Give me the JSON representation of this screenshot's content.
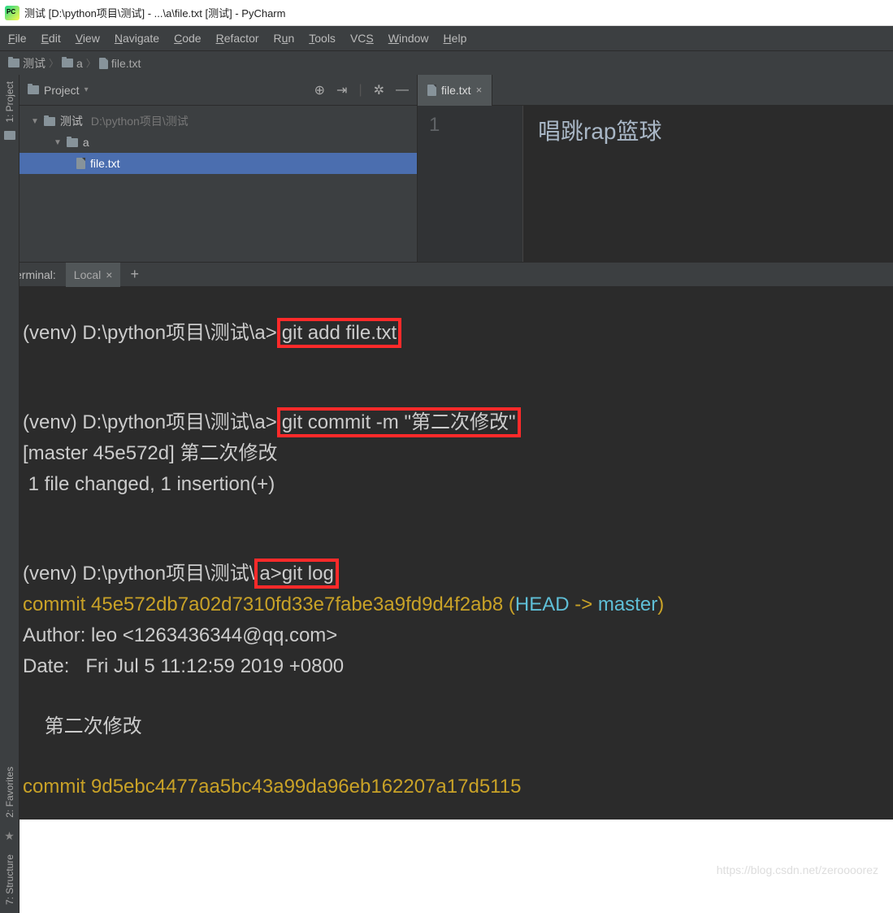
{
  "window": {
    "title": "测试 [D:\\python项目\\测试] - ...\\a\\file.txt [测试] - PyCharm"
  },
  "menu": {
    "file": "File",
    "edit": "Edit",
    "view": "View",
    "navigate": "Navigate",
    "code": "Code",
    "refactor": "Refactor",
    "run": "Run",
    "tools": "Tools",
    "vcs": "VCS",
    "window": "Window",
    "help": "Help"
  },
  "breadcrumbs": {
    "root": "测试",
    "dir": "a",
    "file": "file.txt"
  },
  "side": {
    "project": "1: Project",
    "favorites": "2: Favorites",
    "structure": "7: Structure"
  },
  "project_panel": {
    "title": "Project",
    "root": {
      "name": "测试",
      "path": "D:\\python项目\\测试"
    },
    "dir": "a",
    "file": "file.txt"
  },
  "editor": {
    "tab": "file.txt",
    "ln": "1",
    "content": "唱跳rap篮球"
  },
  "terminal": {
    "label": "Terminal:",
    "tab": "Local",
    "prompt": "(venv) D:\\python项目\\测试\\a>",
    "cmd1": "git add file.txt",
    "cmd2": "git commit -m \"第二次修改\"",
    "out2a": "[master 45e572d] 第二次修改",
    "out2b": " 1 file changed, 1 insertion(+)",
    "cmd3_prefix": "(venv) D:\\python项目\\测试\\",
    "cmd3_box": "a>git log",
    "log_commit1_pre": "commit 45e572db7a02d7310fd33e7fabe3a9fd9d4f2ab8 ",
    "log_commit1_head": "HEAD",
    "log_commit1_arrow": " -> ",
    "log_commit1_branch": "master",
    "log_author": "Author: leo <1263436344@qq.com>",
    "log_date": "Date:   Fri Jul 5 11:12:59 2019 +0800",
    "log_msg": "    第二次修改",
    "log_commit2": "commit 9d5ebc4477aa5bc43a99da96eb162207a17d5115"
  },
  "watermark": "https://blog.csdn.net/zeroooorez"
}
